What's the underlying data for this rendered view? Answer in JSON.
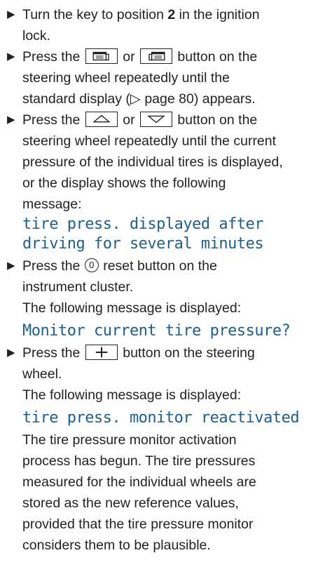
{
  "steps": [
    {
      "lines": [
        "Turn the key to position ",
        "2",
        " in the ignition",
        "lock."
      ]
    },
    {
      "lines": [
        "Press the",
        "or",
        "button on the",
        "steering wheel repeatedly until the",
        "standard display (▷ page 80) appears."
      ],
      "icons": [
        "display-prev-icon",
        "display-next-icon"
      ]
    },
    {
      "lines": [
        "Press the",
        "or",
        "button on the",
        "steering wheel repeatedly until the current",
        "pressure of the individual tires is displayed,",
        "or the display shows the following",
        "message:"
      ],
      "icons": [
        "up-arrow-icon",
        "down-arrow-icon"
      ],
      "message": [
        "tire press. displayed after",
        "driving for several minutes"
      ]
    },
    {
      "lines": [
        "Press the",
        "reset button on the",
        "instrument cluster.",
        "The following message is displayed:"
      ],
      "reset_symbol": "0",
      "message": "Monitor current tire pressure?"
    },
    {
      "lines": [
        "Press the",
        "button on the steering",
        "wheel.",
        "The following message is displayed:"
      ],
      "icons": [
        "plus-icon"
      ],
      "message": "tire press. monitor reactivated"
    }
  ],
  "closing_paragraph": [
    "The tire pressure monitor activation",
    "process has begun. The tire pressures",
    "measured for the individual wheels are",
    "stored as the new reference values,",
    "provided that the tire pressure monitor",
    "considers them to be plausible."
  ],
  "bullet_symbol": "▶",
  "colors": {
    "message_text": "#1d5f8e",
    "body_text": "#222222"
  }
}
